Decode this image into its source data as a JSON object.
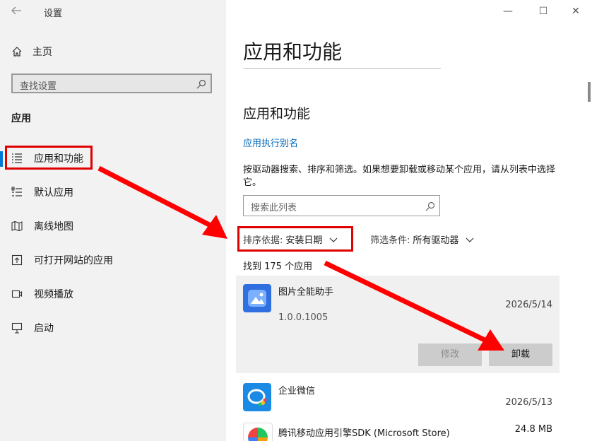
{
  "window": {
    "title": "设置",
    "buttons": [
      "—",
      "☐",
      "✕"
    ]
  },
  "sidebar": {
    "home_label": "主页",
    "search_placeholder": "查找设置",
    "section_title": "应用",
    "items": [
      {
        "label": "应用和功能",
        "icon": "apps-features-icon",
        "active": true
      },
      {
        "label": "默认应用",
        "icon": "default-apps-icon",
        "active": false
      },
      {
        "label": "离线地图",
        "icon": "offline-maps-icon",
        "active": false
      },
      {
        "label": "可打开网站的应用",
        "icon": "apps-for-websites-icon",
        "active": false
      },
      {
        "label": "视频播放",
        "icon": "video-playback-icon",
        "active": false
      },
      {
        "label": "启动",
        "icon": "startup-icon",
        "active": false
      }
    ]
  },
  "main": {
    "page_title": "应用和功能",
    "sub_title": "应用和功能",
    "alias_link": "应用执行别名",
    "description": "按驱动器搜索、排序和筛选。如果想要卸载或移动某个应用，请从列表中选择它。",
    "list_search_placeholder": "搜索此列表",
    "sort_key": "排序依据:",
    "sort_value": "安装日期",
    "filter_key": "筛选条件:",
    "filter_value": "所有驱动器",
    "count_text": "找到 175 个应用",
    "apps": [
      {
        "name": "图片全能助手",
        "date": "2026/5/14",
        "version": "1.0.0.1005",
        "modify_label": "修改",
        "uninstall_label": "卸载",
        "expanded": true
      },
      {
        "name": "企业微信",
        "date": "2026/5/13"
      },
      {
        "name": "腾讯移动应用引擎SDK (Microsoft Store)",
        "size": "24.8 MB"
      }
    ]
  },
  "colors": {
    "accent": "#0078d7",
    "link": "#0067b8",
    "highlight": "#e00000",
    "sidebar_bg": "#f2f2f2"
  }
}
